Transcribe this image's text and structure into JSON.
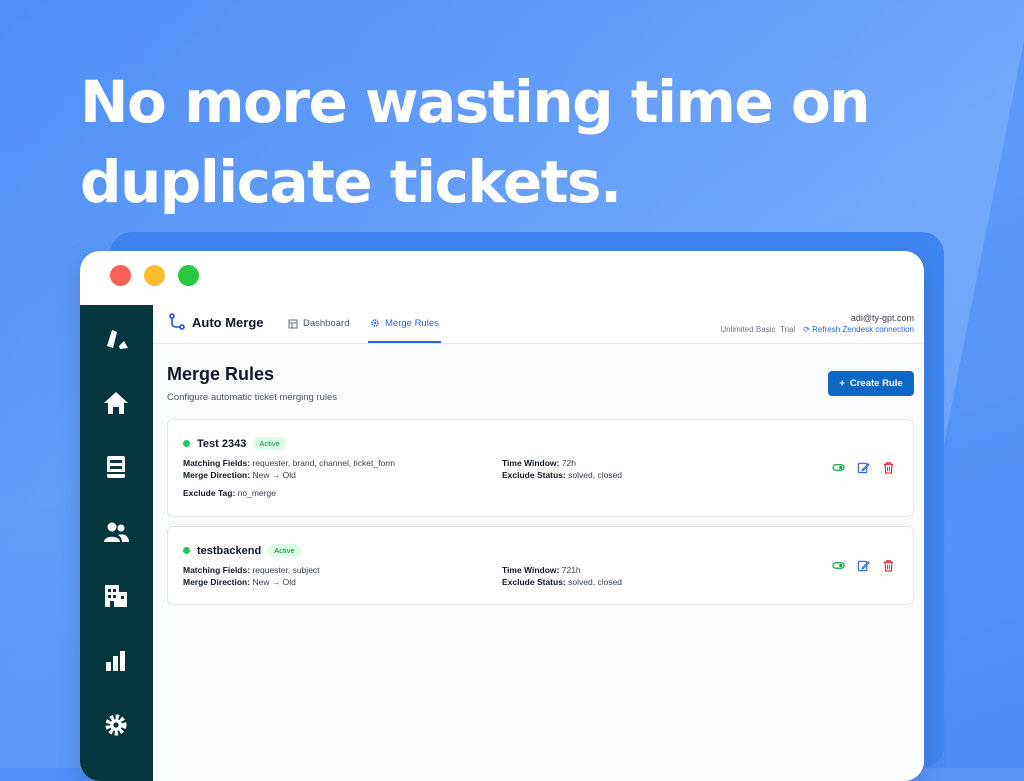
{
  "headline": {
    "line1": "No more wasting time on",
    "line2": "duplicate tickets."
  },
  "colors": {
    "accent": "#0f67c5",
    "sidebar": "#05363d",
    "active": "#22c55e",
    "delete": "#dc2626"
  },
  "sidebar": {
    "items": [
      {
        "icon": "logo-icon"
      },
      {
        "icon": "home-icon"
      },
      {
        "icon": "inbox-icon"
      },
      {
        "icon": "users-icon"
      },
      {
        "icon": "building-icon"
      },
      {
        "icon": "chart-icon"
      },
      {
        "icon": "gear-icon"
      }
    ]
  },
  "app": {
    "name": "Auto Merge",
    "tabs": [
      {
        "label": "Dashboard",
        "icon": "dashboard-icon",
        "active": false
      },
      {
        "label": "Merge Rules",
        "icon": "gear-icon",
        "active": true
      }
    ]
  },
  "account": {
    "email": "adi@ty-gpt.com",
    "plan": "Unlimited Basic",
    "plan_status": "Trial",
    "refresh_label": "Refresh Zendesk connection"
  },
  "page": {
    "title": "Merge Rules",
    "subtitle": "Configure automatic ticket merging rules",
    "create_label": "Create Rule"
  },
  "rules": [
    {
      "name": "Test 2343",
      "status": "Active",
      "matching_label": "Matching Fields:",
      "matching": "requester, brand, channel, ticket_form",
      "direction_label": "Merge Direction:",
      "direction": "New → Old",
      "window_label": "Time Window:",
      "window": "72h",
      "exclude_status_label": "Exclude Status:",
      "exclude_status": "solved, closed",
      "exclude_tag_label": "Exclude Tag:",
      "exclude_tag": "no_merge"
    },
    {
      "name": "testbackend",
      "status": "Active",
      "matching_label": "Matching Fields:",
      "matching": "requester, subject",
      "direction_label": "Merge Direction:",
      "direction": "New → Old",
      "window_label": "Time Window:",
      "window": "721h",
      "exclude_status_label": "Exclude Status:",
      "exclude_status": "solved, closed"
    }
  ]
}
